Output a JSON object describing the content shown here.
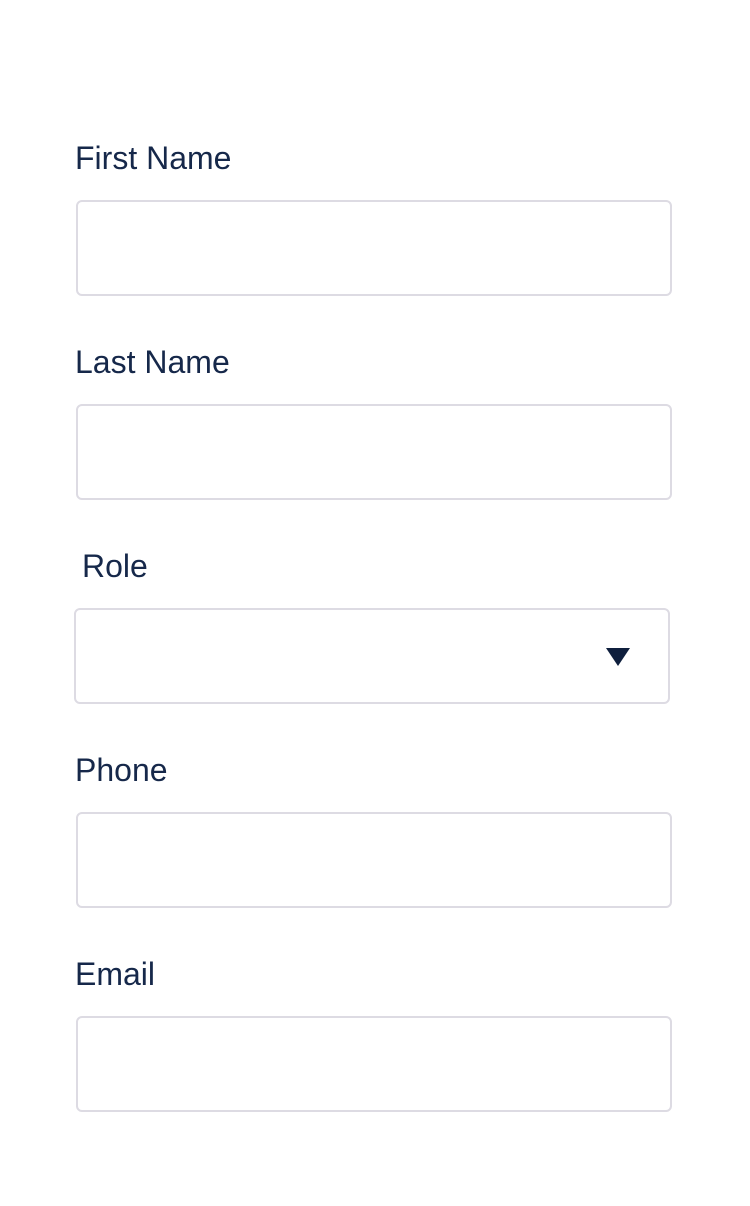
{
  "form": {
    "first_name": {
      "label": "First Name",
      "value": "",
      "placeholder": ""
    },
    "last_name": {
      "label": "Last Name",
      "value": "",
      "placeholder": ""
    },
    "role": {
      "label": "Role",
      "selected": "",
      "icon": "chevron-down-icon"
    },
    "phone": {
      "label": "Phone",
      "value": "",
      "placeholder": ""
    },
    "email": {
      "label": "Email",
      "value": "",
      "placeholder": ""
    }
  }
}
